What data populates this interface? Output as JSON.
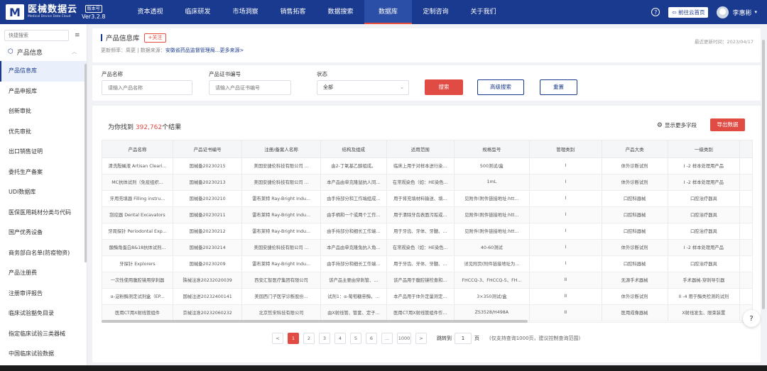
{
  "brand": {
    "logo_char": "M",
    "title": "医械数据云",
    "subtitle": "Medical Device Data Cloud",
    "version_badge": "版本号",
    "version": "Ver3.2.8"
  },
  "nav": [
    {
      "label": "资本透视"
    },
    {
      "label": "临床研发"
    },
    {
      "label": "市场洞察"
    },
    {
      "label": "销售拓客"
    },
    {
      "label": "数据搜索"
    },
    {
      "label": "数据库"
    },
    {
      "label": "定制咨询"
    },
    {
      "label": "关于我们"
    }
  ],
  "top_right": {
    "help": "?",
    "old_site": "前往云首页",
    "user": "李惠彬"
  },
  "sidebar": {
    "search_placeholder": "快捷搜索",
    "group": "产品信息",
    "items": [
      {
        "label": "产品信息库"
      },
      {
        "label": "产品申报库"
      },
      {
        "label": "创新审批"
      },
      {
        "label": "优先审批"
      },
      {
        "label": "出口销售证明"
      },
      {
        "label": "委托生产备案"
      },
      {
        "label": "UDI数据库"
      },
      {
        "label": "医保医用耗材分类与代码"
      },
      {
        "label": "国产优秀设备"
      },
      {
        "label": "商务部白名单(防疫物资)"
      },
      {
        "label": "产品注册费"
      },
      {
        "label": "注册审评报告"
      },
      {
        "label": "临床试验豁免目录"
      },
      {
        "label": "指定临床试验三类器械"
      },
      {
        "label": "中国临床试验数据"
      }
    ]
  },
  "header": {
    "title": "产品信息库",
    "follow": "+关注",
    "meta_prefix": "更新频率：周更 | 数据来源：",
    "meta_link": "安徽省药品监督管理局...更多来源>",
    "updated": "最近更新时间：2023/04/17"
  },
  "filters": {
    "name_label": "产品名称",
    "name_placeholder": "请输入产品名称",
    "cert_label": "产品证书编号",
    "cert_placeholder": "请输入产品证书编号",
    "status_label": "状态",
    "status_value": "全部",
    "search": "搜索",
    "advanced": "高级搜索",
    "reset": "重置"
  },
  "results": {
    "prefix": "为你找到 ",
    "count": "392,762",
    "suffix": "个结果",
    "more_fields": "显示更多字段",
    "export": "导出数据"
  },
  "table": {
    "columns": [
      "产品名称",
      "产品证书编号",
      "注册/备案人名称",
      "结构及组成",
      "适用范围",
      "规格型号",
      "管理类别",
      "产品大类",
      "一级类别",
      "二级类别"
    ],
    "rows": [
      [
        "清洗殷蝇液 Artisan Cleari...",
        "国械备20230215",
        "美国安捷伦科技有限公司 ...",
        "由2-丁氧基乙醇组成。",
        "临床上用于对样本进行染...",
        "500测试/盒",
        "I",
        "体外诊断试剂",
        "I -2 样本处理用产品",
        "-"
      ],
      [
        "MC抗体试剂（免疫组织...",
        "国械备20230213",
        "美国安捷伦科技有限公司 ...",
        "本产品由单克隆鼠抗人同...",
        "在常规染色（如：HE染色...",
        "1mL",
        "I",
        "体外诊断试剂",
        "I -2 样本处理用产品",
        "-"
      ],
      [
        "牙用充填器 Filling instru...",
        "国械备20230210",
        "雷布莱特 Ray-Bright Indu...",
        "由手持部分和工作端组成...",
        "用于将充填材料输送、填...",
        "见附件(附件链接地址:htt...",
        "I",
        "口腔科器械",
        "口腔治疗器具",
        "材料输送器具"
      ],
      [
        "刮挖器 Dental Excavators",
        "国械备20230211",
        "雷布莱特 Ray-Bright Indu...",
        "由手柄和一个或两个工作...",
        "用于清除牙齿表面污垢或...",
        "见附件(附件链接地址:htt...",
        "I",
        "口腔科器械",
        "口腔治疗器具",
        "洁治器具"
      ],
      [
        "牙周探针 Periodontal Exp...",
        "国械备20230212",
        "雷布莱特 Ray-Bright Indu...",
        "由手持部分和细长工作端...",
        "用于牙齿、牙体、牙髓、...",
        "见附件(附件链接地址:htt...",
        "I",
        "口腔科器械",
        "口腔治疗器具",
        "口腔针"
      ],
      [
        "酸酶角蛋白8&18抗体试剂...",
        "国械备20230214",
        "美国安捷伦科技有限公司 ...",
        "本产品由单克隆兔抗人角...",
        "在常规染色（如：HE染色...",
        "40-60测试",
        "I",
        "体外诊断试剂",
        "I -2 样本处理用产品",
        "-"
      ],
      [
        "牙探针 Explorers",
        "国械备20230209",
        "雷布莱特 Ray-Bright Indu...",
        "由手持部分和细长工作端...",
        "用于牙齿、牙体、牙髓、...",
        "详见附页(附件链接地址为...",
        "I",
        "口腔科器械",
        "口腔治疗器具",
        "口腔针"
      ],
      [
        "一次性使用腹腔镜用穿刺器",
        "陕械注准20232020039",
        "西安汇智医疗集团有限公司",
        "该产品主要由穿刺管、...",
        "该产品用于腹腔镜检查和...",
        "FHCCQ-3、FHCCQ-5、FH...",
        "II",
        "无源手术器械",
        "手术器械-穿刺导引器",
        "穿刺器"
      ],
      [
        "α-淀粉酶测定试剂盒（EP...",
        "国械注进20232400141",
        "美国西门子医学诊断股份...",
        "试剂1：α-葡萄糖苷酶，...",
        "本产品用于体外定量测定...",
        "3×350测试/盒",
        "II",
        "体外诊断试剂",
        "II -4 用于酶类检测的试剂",
        "α-淀粉酶检测试剂"
      ],
      [
        "医用CT用X射线管组件",
        "京械注准20232060232",
        "北京哲宋科技有限公司",
        "由X射线管、管套、定子...",
        "医用CT用X射线管组件作...",
        "ZS3528/H498A",
        "II",
        "医用成像器械",
        "X射线发生、限束装置",
        "X射线管组件"
      ]
    ]
  },
  "pager": {
    "prev": "<",
    "pages": [
      "1",
      "2",
      "3",
      "4",
      "5",
      "6",
      "...",
      "1000"
    ],
    "next": ">",
    "jump_label": "跳转到",
    "jump_value": "1",
    "jump_unit": "页",
    "note": "(仅支持查询1000页，建议控制查询范围)"
  }
}
